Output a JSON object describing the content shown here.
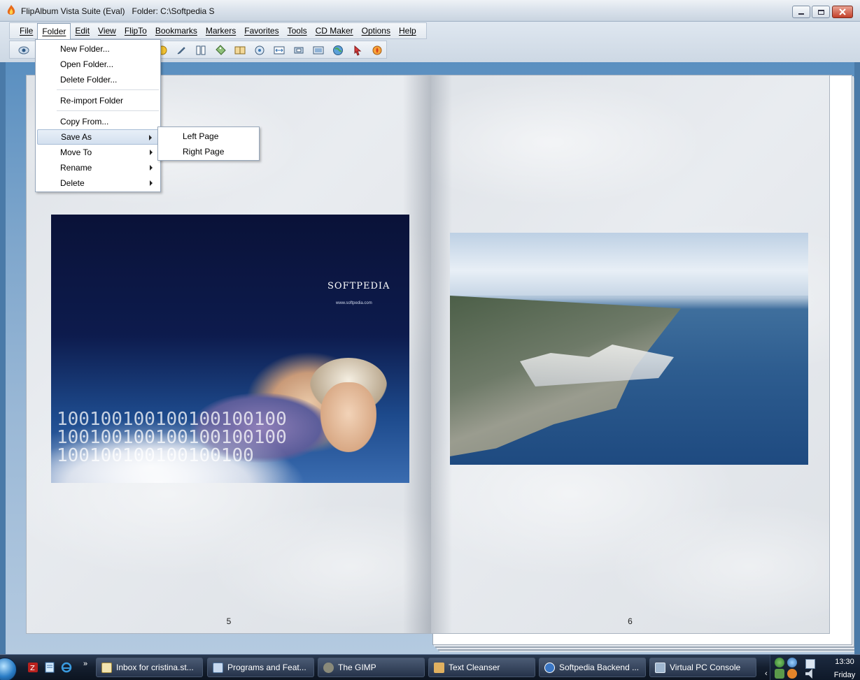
{
  "window": {
    "title": "FlipAlbum Vista Suite (Eval)   Folder: C:\\Softpedia S"
  },
  "menubar": {
    "items": [
      "File",
      "Folder",
      "Edit",
      "View",
      "FlipTo",
      "Bookmarks",
      "Markers",
      "Favorites",
      "Tools",
      "CD Maker",
      "Options",
      "Help"
    ]
  },
  "folder_menu": {
    "items": [
      "New Folder...",
      "Open Folder...",
      "Delete Folder...",
      "Re-import Folder",
      "Copy From...",
      "Save As",
      "Move To",
      "Rename",
      "Delete"
    ]
  },
  "save_as_submenu": {
    "items": [
      "Left Page",
      "Right Page"
    ]
  },
  "book": {
    "left_page_number": "5",
    "right_page_number": "6",
    "left_photo_brand": "SOFTPEDIA",
    "left_photo_url": "www.softpedia.com"
  },
  "taskbar": {
    "buttons": [
      "Inbox for cristina.st...",
      "Programs and Feat...",
      "The GIMP",
      "Text Cleanser",
      "Softpedia Backend ...",
      "Virtual PC Console"
    ],
    "quick_launch_more": "»",
    "clock_time": "13:30",
    "clock_day": "Friday"
  },
  "colors": {
    "menu_highlight": "#d3e0ef",
    "taskbar": "#141e2e",
    "desktop": "#4a7aa8"
  }
}
